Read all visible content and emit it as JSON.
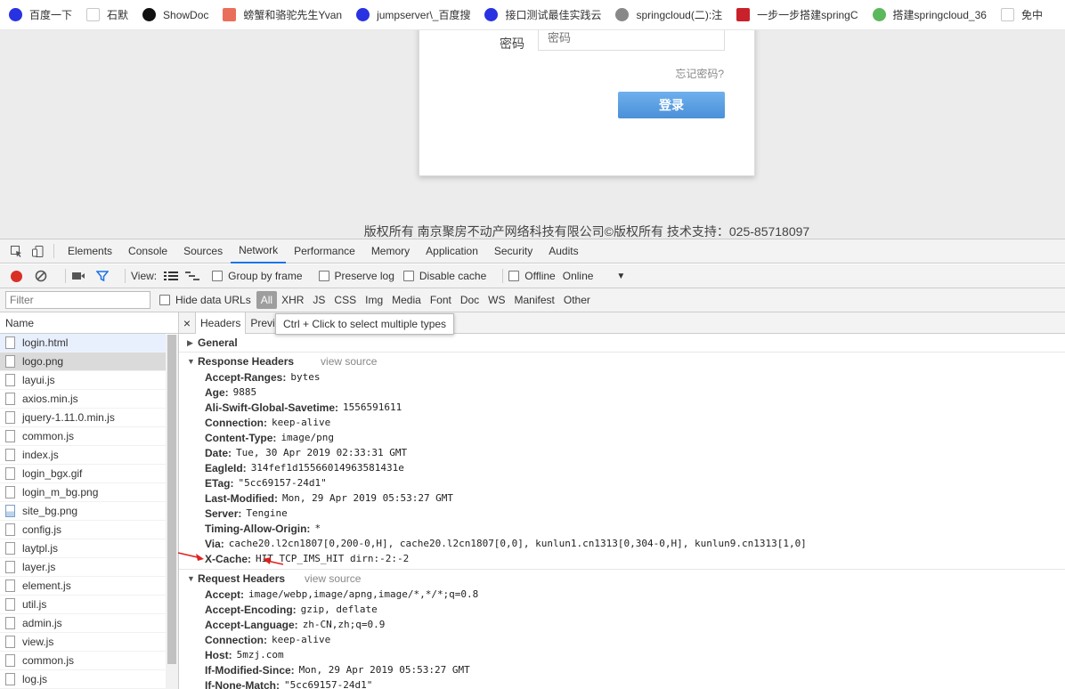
{
  "bookmarks": [
    {
      "label": "百度一下",
      "icon": "baidu-paw-icon",
      "color": "#2932e1"
    },
    {
      "label": "石默",
      "icon": "page-icon",
      "color": "#c8c8c8"
    },
    {
      "label": "ShowDoc",
      "icon": "showdoc-icon",
      "color": "#111111"
    },
    {
      "label": "螃蟹和骆驼先生Yvan",
      "icon": "jianshu-icon",
      "color": "#ea6f5a"
    },
    {
      "label": "jumpserver\\_百度搜",
      "icon": "baidu-paw-icon",
      "color": "#2932e1"
    },
    {
      "label": "接口测试最佳实践云",
      "icon": "baidu-paw-icon",
      "color": "#2932e1"
    },
    {
      "label": "springcloud(二):注",
      "icon": "cnblogs-icon",
      "color": "#888888"
    },
    {
      "label": "一步一步搭建springC",
      "icon": "csdn-icon",
      "color": "#c9212b"
    },
    {
      "label": "搭建springcloud_36",
      "icon": "360-icon",
      "color": "#5cb85c"
    },
    {
      "label": "免中",
      "icon": "page-icon",
      "color": "#c8c8c8"
    }
  ],
  "login": {
    "password_label": "密码",
    "password_placeholder": "密码",
    "forgot_link": "忘记密码?",
    "submit": "登录"
  },
  "footer": {
    "copyright": "版权所有 南京聚房不动产网络科技有限公司©版权所有 技术支持：025-85718097"
  },
  "devtools": {
    "tabs": [
      "Elements",
      "Console",
      "Sources",
      "Network",
      "Performance",
      "Memory",
      "Application",
      "Security",
      "Audits"
    ],
    "active_tab": "Network",
    "toolbar": {
      "view_label": "View:",
      "group_by_frame": "Group by frame",
      "preserve_log": "Preserve log",
      "disable_cache": "Disable cache",
      "offline": "Offline",
      "throttle": "Online"
    },
    "filter": {
      "placeholder": "Filter",
      "hide_data_urls": "Hide data URLs",
      "types": [
        "All",
        "XHR",
        "JS",
        "CSS",
        "Img",
        "Media",
        "Font",
        "Doc",
        "WS",
        "Manifest",
        "Other"
      ],
      "active_type": "All"
    },
    "list": {
      "header": "Name",
      "files": [
        {
          "name": "login.html",
          "kind": "doc"
        },
        {
          "name": "logo.png",
          "kind": "doc"
        },
        {
          "name": "layui.js",
          "kind": "doc"
        },
        {
          "name": "axios.min.js",
          "kind": "doc"
        },
        {
          "name": "jquery-1.11.0.min.js",
          "kind": "doc"
        },
        {
          "name": "common.js",
          "kind": "doc"
        },
        {
          "name": "index.js",
          "kind": "doc"
        },
        {
          "name": "login_bgx.gif",
          "kind": "doc"
        },
        {
          "name": "login_m_bg.png",
          "kind": "doc"
        },
        {
          "name": "site_bg.png",
          "kind": "img"
        },
        {
          "name": "config.js",
          "kind": "doc"
        },
        {
          "name": "laytpl.js",
          "kind": "doc"
        },
        {
          "name": "layer.js",
          "kind": "doc"
        },
        {
          "name": "element.js",
          "kind": "doc"
        },
        {
          "name": "util.js",
          "kind": "doc"
        },
        {
          "name": "admin.js",
          "kind": "doc"
        },
        {
          "name": "view.js",
          "kind": "doc"
        },
        {
          "name": "common.js",
          "kind": "doc"
        },
        {
          "name": "log.js",
          "kind": "doc"
        }
      ]
    },
    "detail": {
      "close": "×",
      "tabs": [
        "Headers",
        "Previe"
      ],
      "tooltip": "Ctrl + Click to select multiple types",
      "general": "General",
      "response_title": "Response Headers",
      "request_title": "Request Headers",
      "view_source": "view source",
      "response_headers": [
        {
          "k": "Accept-Ranges:",
          "v": "bytes"
        },
        {
          "k": "Age:",
          "v": "9885"
        },
        {
          "k": "Ali-Swift-Global-Savetime:",
          "v": "1556591611"
        },
        {
          "k": "Connection:",
          "v": "keep-alive"
        },
        {
          "k": "Content-Type:",
          "v": "image/png"
        },
        {
          "k": "Date:",
          "v": "Tue, 30 Apr 2019 02:33:31 GMT"
        },
        {
          "k": "EagleId:",
          "v": "314fef1d15566014963581431e"
        },
        {
          "k": "ETag:",
          "v": "\"5cc69157-24d1\""
        },
        {
          "k": "Last-Modified:",
          "v": "Mon, 29 Apr 2019 05:53:27 GMT"
        },
        {
          "k": "Server:",
          "v": "Tengine"
        },
        {
          "k": "Timing-Allow-Origin:",
          "v": "*"
        },
        {
          "k": "Via:",
          "v": "cache20.l2cn1807[0,200-0,H], cache20.l2cn1807[0,0], kunlun1.cn1313[0,304-0,H], kunlun9.cn1313[1,0]"
        },
        {
          "k": "X-Cache:",
          "v": "HIT TCP_IMS_HIT dirn:-2:-2"
        }
      ],
      "request_headers": [
        {
          "k": "Accept:",
          "v": "image/webp,image/apng,image/*,*/*;q=0.8"
        },
        {
          "k": "Accept-Encoding:",
          "v": "gzip, deflate"
        },
        {
          "k": "Accept-Language:",
          "v": "zh-CN,zh;q=0.9"
        },
        {
          "k": "Connection:",
          "v": "keep-alive"
        },
        {
          "k": "Host:",
          "v": "5mzj.com"
        },
        {
          "k": "If-Modified-Since:",
          "v": "Mon, 29 Apr 2019 05:53:27 GMT"
        },
        {
          "k": "If-None-Match:",
          "v": "\"5cc69157-24d1\""
        }
      ]
    }
  }
}
